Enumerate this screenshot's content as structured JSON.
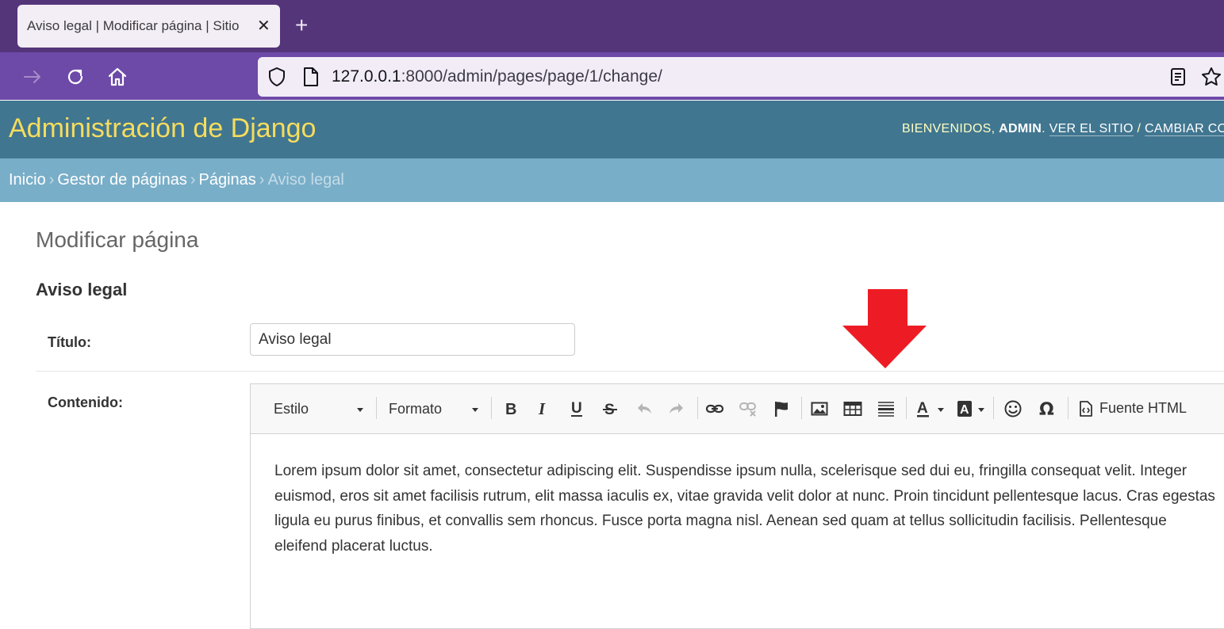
{
  "browser": {
    "tab_title": "Aviso legal | Modificar página | Sitio",
    "tab_close": "✕",
    "new_tab": "+",
    "url_host": "127.0.0.1",
    "url_rest": ":8000/admin/pages/page/1/change/"
  },
  "header": {
    "site_title": "Administración de Django",
    "welcome": "BIENVENIDOS, ",
    "username": "ADMIN",
    "period": ". ",
    "view_site": "VER EL SITIO",
    "slash": " / ",
    "change_password": "CAMBIAR CO"
  },
  "breadcrumbs": {
    "home": "Inicio",
    "app": "Gestor de páginas",
    "model": "Páginas",
    "current": "Aviso legal",
    "separator": "›"
  },
  "content": {
    "heading": "Modificar página",
    "object_title": "Aviso legal",
    "titulo_label": "Título:",
    "titulo_value": "Aviso legal",
    "contenido_label": "Contenido:"
  },
  "editor": {
    "style_combo": "Estilo",
    "format_combo": "Formato",
    "source_button": "Fuente HTML",
    "icons": [
      "bold-icon",
      "italic-icon",
      "underline-icon",
      "strike-icon",
      "undo-icon",
      "redo-icon",
      "link-icon",
      "unlink-icon",
      "anchor-icon",
      "image-icon",
      "table-icon",
      "horizontal-rule-icon",
      "text-color-icon",
      "bg-color-icon",
      "smiley-icon",
      "special-char-icon",
      "source-icon"
    ],
    "body_text": "Lorem ipsum dolor sit amet, consectetur adipiscing elit. Suspendisse ipsum nulla, scelerisque sed dui eu, fringilla consequat velit. Integer euismod, eros sit amet facilisis rutrum, elit massa iaculis ex, vitae gravida velit dolor at nunc. Proin tincidunt pellentesque lacus. Cras egestas ligula eu purus finibus, et convallis sem rhoncus. Fusce porta magna nisl. Aenean sed quam at tellus sollicitudin facilisis. Pellentesque eleifend placerat luctus."
  },
  "colors": {
    "browser_tabbar": "#54357a",
    "browser_navbar": "#6d49a8",
    "django_header": "#417690",
    "django_title": "#f5dd5d",
    "breadcrumbs": "#79aec8",
    "annotation_arrow": "#ed1c24"
  }
}
